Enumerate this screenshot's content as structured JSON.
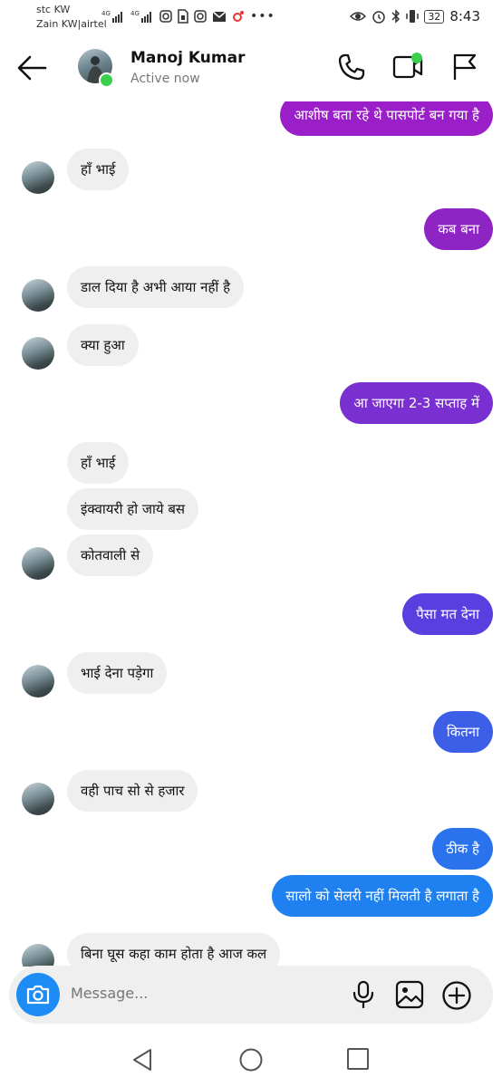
{
  "status_bar": {
    "carrier_1": "stc KW",
    "carrier_2": "Zain KW|airtel",
    "battery": "32",
    "time": "8:43"
  },
  "header": {
    "contact_name": "Manoj Kumar",
    "status": "Active now"
  },
  "messages": [
    {
      "side": "out",
      "text": "आशीष बता रहे थे पासपोर्ट बन गया है",
      "color": "#9A1FC8"
    },
    {
      "side": "in",
      "text": "हाँ भाई"
    },
    {
      "side": "out",
      "text": "कब बना",
      "color": "#8E24C4"
    },
    {
      "side": "in",
      "text": "डाल दिया है अभी आया नहीं है"
    },
    {
      "side": "in",
      "text": "क्या हुआ"
    },
    {
      "side": "out",
      "text": "आ जाएगा 2-3 सप्ताह में",
      "color": "#7A30D0"
    },
    {
      "side": "in",
      "text": "हाँ भाई"
    },
    {
      "side": "in",
      "text": "इंक्वायरी हो जाये बस"
    },
    {
      "side": "in",
      "text": "कोतवाली से"
    },
    {
      "side": "out",
      "text": "पैसा मत देना",
      "color": "#5A3FE0"
    },
    {
      "side": "in",
      "text": "भाई देना पड़ेगा"
    },
    {
      "side": "out",
      "text": "कितना",
      "color": "#3D5EE6"
    },
    {
      "side": "in",
      "text": "वही पाच सो से हजार"
    },
    {
      "side": "out",
      "text": "ठीक है",
      "color": "#2A73EC"
    },
    {
      "side": "out",
      "text": "सालो को सेलरी नहीं मिलती है लगाता है",
      "color": "#1F80F0"
    },
    {
      "side": "in",
      "text": "बिना घूस कहा काम होता है आज कल"
    }
  ],
  "composer": {
    "placeholder": "Message..."
  }
}
